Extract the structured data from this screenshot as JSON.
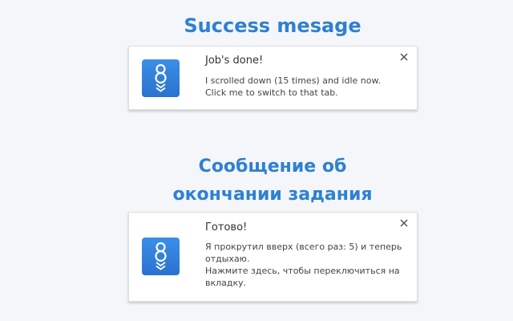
{
  "colors": {
    "background": "#f4f6f9",
    "heading": "#2f80d1",
    "icon_top": "#3b8fe6",
    "icon_bottom": "#2a72cf"
  },
  "sections": {
    "success": {
      "heading": "Success mesage",
      "notification": {
        "icon": "app-logo-icon",
        "title": "Job's done!",
        "lines": [
          "I scrolled down (15 times) and idle now.",
          "Click me to switch to that tab."
        ],
        "close_icon": "close-icon"
      }
    },
    "completion": {
      "heading_lines": [
        "Сообщение об",
        "окончании задания"
      ],
      "notification": {
        "icon": "app-logo-icon",
        "title": "Готово!",
        "lines": [
          "Я прокрутил вверх (всего раз: 5) и теперь",
          "отдыхаю.",
          "Нажмите здесь, чтобы переключиться на",
          "вкладку."
        ],
        "close_icon": "close-icon"
      }
    }
  }
}
